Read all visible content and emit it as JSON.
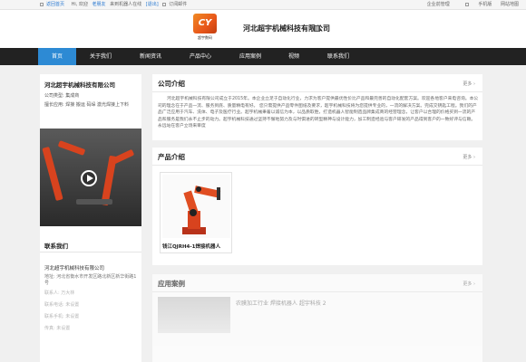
{
  "topbar": {
    "home": "返回首页",
    "welcome": "Hi, 欢迎",
    "user": "老朋友",
    "tagline": "来到机器人在线",
    "exit": "[退出]",
    "order": "订阅邮件",
    "right_links": [
      "企业前管理",
      "手机版",
      "网站地图"
    ]
  },
  "header": {
    "logo_mark": "CY",
    "logo_text": "超宇数码",
    "company_name": "河北超宇机械科技有限公司"
  },
  "nav": {
    "items": [
      "首页",
      "关于我们",
      "新闻资讯",
      "产品中心",
      "应用案例",
      "视频",
      "联系我们"
    ],
    "active_index": 0
  },
  "sidebar": {
    "company_name": "河北超宇机械科技有限公司",
    "type_label": "公司类型:",
    "type_value": "集成商",
    "scope_label": "擅长应用:",
    "scope_value": "焊接 搬运 码垛 激光焊接上下料",
    "contact_title": "联系我们",
    "contact_company": "河北超宇机械科技有限公司",
    "address_label": "地址:",
    "address_value": "河北省衡水市开发区路北新区新华街路1号",
    "contact_label": "联系人:",
    "contact_value": "万大林",
    "phone_label": "联系电话:",
    "phone_value": "未设置",
    "mobile_label": "联系手机:",
    "mobile_value": "未设置",
    "fax_label": "传真:",
    "fax_value": "未设置"
  },
  "intro": {
    "title": "公司介绍",
    "more": "更多",
    "text": "河北超宇机械科技有限公司成立于2015年。本企业立足于自动化行业，力求为客户提供最优性价比产品和最完善的自动化配套方案。欢迎各地客户来电咨询。本公司的理念在于产品一流、服务到底、质量精电有好。 您只需提供产品零件图纸及要求，超宇机械科技将为您提供专业的，一流的解决方案。完成交钥匙工程。我们的产品广泛应用于汽车、洗体、电子及医疗行业。超宇机械秉着以诚信为本，以品质取胜，打造机器人智能制造品牌集成商的经营理念，让客户以合理的价格买到一流的产品和服务是我们永不止步的动力。超宇机械科技通过坚持不懈地努力及与时俱进的转型精神与设计能力，加工制造经验与客户研发的产品得到客户的一致好评与信赖。永远站在客户立场来审度"
  },
  "products": {
    "title": "产品介绍",
    "more": "更多",
    "items": [
      {
        "caption": "钱江QJRH4-1焊接机器人"
      }
    ]
  },
  "cases": {
    "title": "应用案例",
    "more": "更多",
    "items": [
      {
        "caption": "农膜加工行业  焊接机器人  超宇科技 2"
      }
    ]
  },
  "colors": {
    "nav_bg": "#222222",
    "nav_active": "#2d8ad4",
    "brand_orange": "#e8561a"
  }
}
